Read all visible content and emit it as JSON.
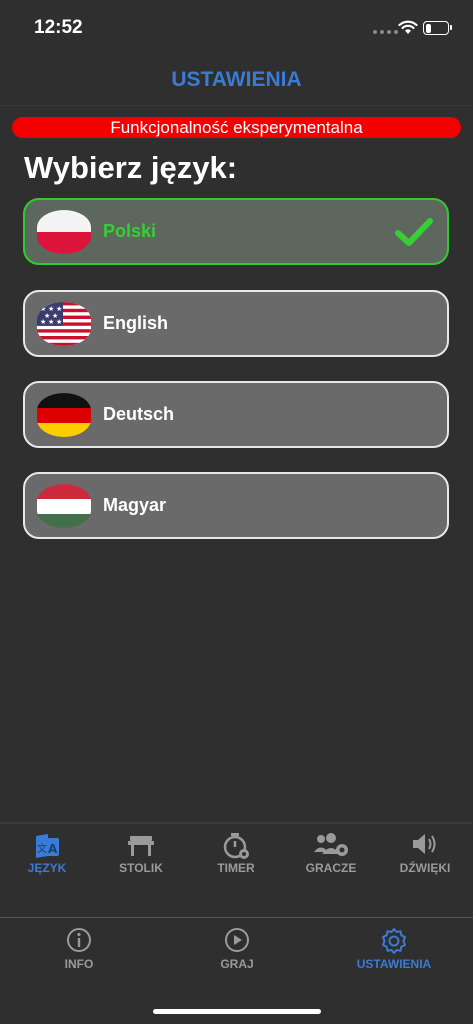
{
  "status_bar": {
    "time": "12:52",
    "battery_level": 0.25
  },
  "header": {
    "title": "USTAWIENIA"
  },
  "banner": {
    "text": "Funkcjonalność eksperymentalna",
    "color": "#f40000"
  },
  "section": {
    "title": "Wybierz język:"
  },
  "languages": [
    {
      "label": "Polski",
      "flag": "poland-flag-icon",
      "selected": true
    },
    {
      "label": "English",
      "flag": "usa-flag-icon",
      "selected": false
    },
    {
      "label": "Deutsch",
      "flag": "germany-flag-icon",
      "selected": false
    },
    {
      "label": "Magyar",
      "flag": "hungary-flag-icon",
      "selected": false
    }
  ],
  "settings_tabs": [
    {
      "label": "JĘZYK",
      "icon": "language-icon",
      "active": true
    },
    {
      "label": "STOLIK",
      "icon": "table-icon",
      "active": false
    },
    {
      "label": "TIMER",
      "icon": "timer-icon",
      "active": false
    },
    {
      "label": "GRACZE",
      "icon": "players-icon",
      "active": false
    },
    {
      "label": "DŹWIĘKI",
      "icon": "speaker-icon",
      "active": false
    }
  ],
  "bottom_nav": [
    {
      "label": "INFO",
      "icon": "info-icon",
      "active": false
    },
    {
      "label": "GRAJ",
      "icon": "play-icon",
      "active": false
    },
    {
      "label": "USTAWIENIA",
      "icon": "gear-icon",
      "active": true
    }
  ],
  "colors": {
    "accent": "#3a7bd5",
    "selected": "#35d035",
    "inactive": "#9a9a9a",
    "background": "#2f2f2f"
  }
}
